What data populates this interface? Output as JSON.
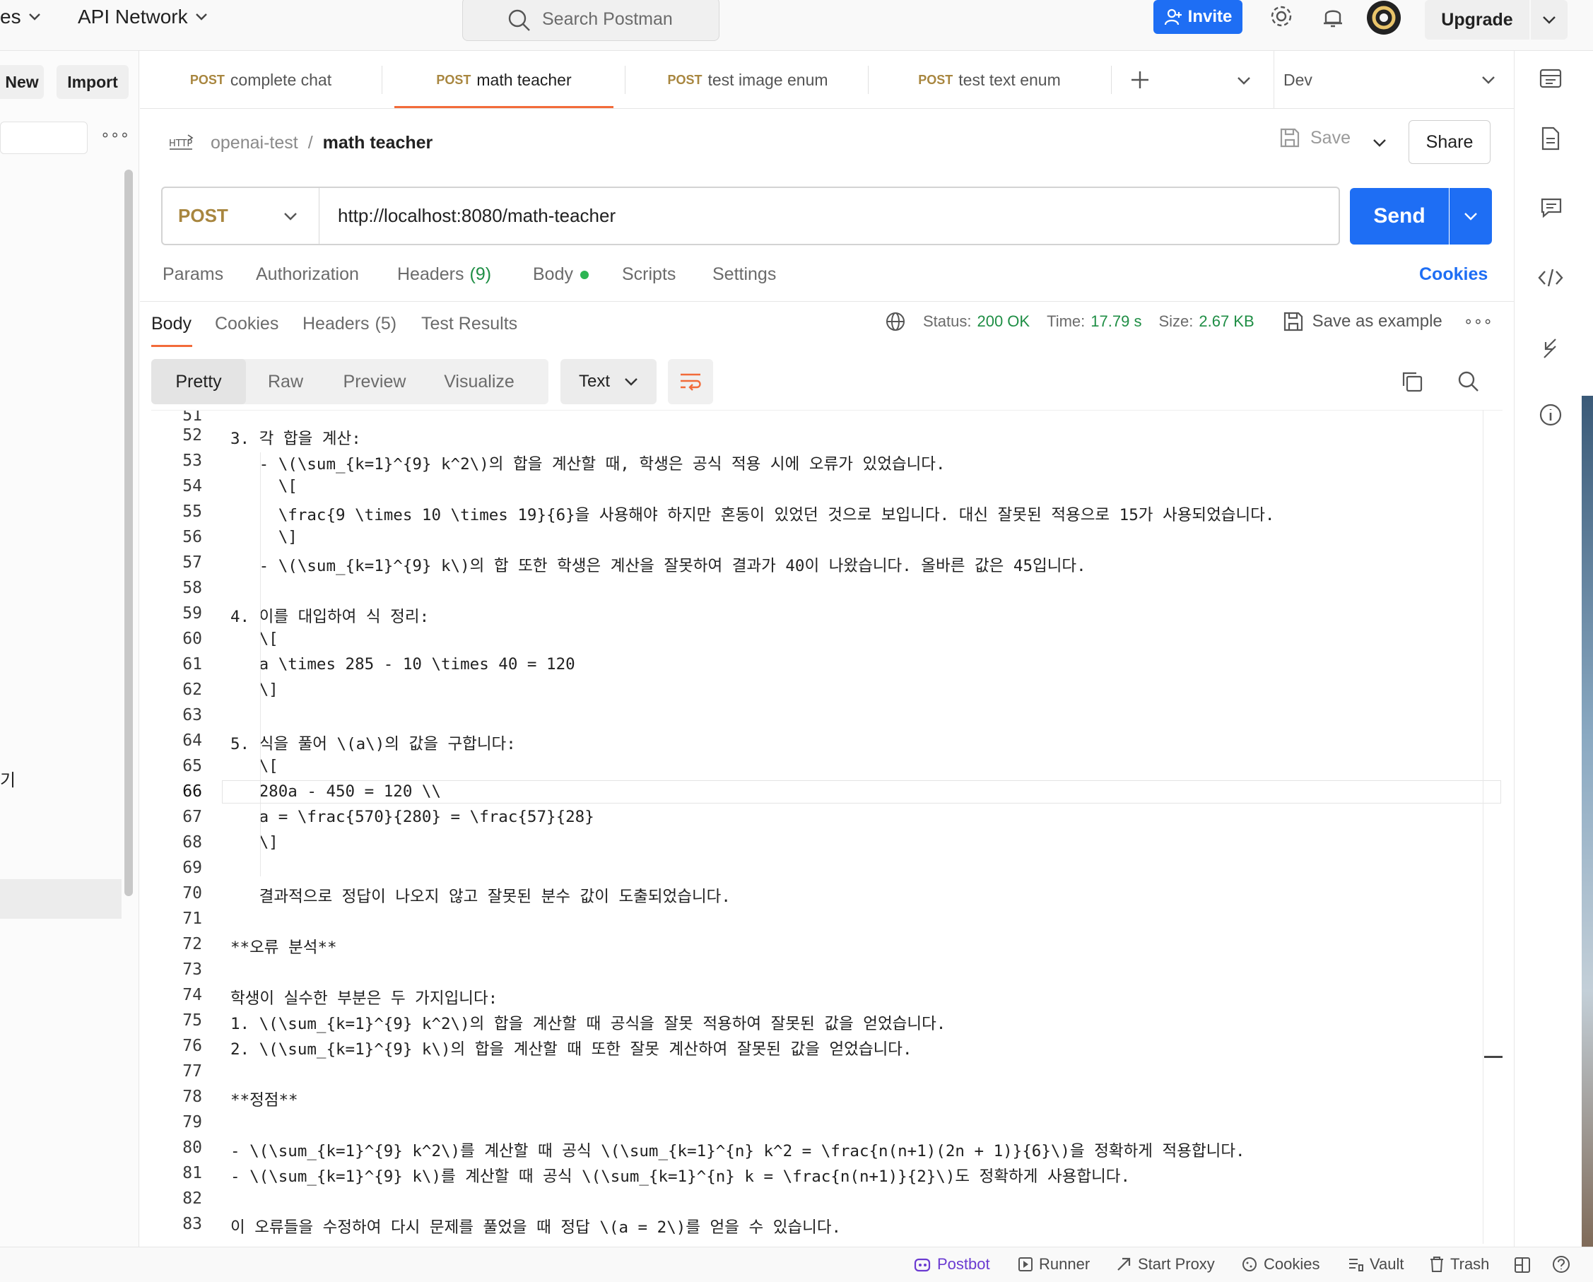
{
  "topbar": {
    "workspace_label": "es",
    "network_label": "API Network",
    "search_placeholder": "Search Postman",
    "invite_label": "Invite",
    "upgrade_label": "Upgrade"
  },
  "sidebar": {
    "new_label": "New",
    "import_label": "Import",
    "more_label": "∘∘∘",
    "partial_item": "기"
  },
  "tabs": [
    {
      "method": "POST",
      "label": "complete chat"
    },
    {
      "method": "POST",
      "label": "math teacher"
    },
    {
      "method": "POST",
      "label": "test image enum"
    },
    {
      "method": "POST",
      "label": "test text enum"
    }
  ],
  "environment": "Dev",
  "breadcrumb": {
    "collection": "openai-test",
    "separator": "/",
    "request": "math teacher"
  },
  "actions": {
    "save_label": "Save",
    "share_label": "Share"
  },
  "request": {
    "method": "POST",
    "url": "http://localhost:8080/math-teacher",
    "send_label": "Send",
    "tabs": [
      "Params",
      "Authorization",
      "Headers",
      "Body",
      "Scripts",
      "Settings"
    ],
    "headers_count": "(9)",
    "cookies_label": "Cookies"
  },
  "response": {
    "tabs": [
      "Body",
      "Cookies",
      "Headers",
      "Test Results"
    ],
    "headers_count": "(5)",
    "status_label": "Status:",
    "status_value": "200 OK",
    "time_label": "Time:",
    "time_value": "17.79 s",
    "size_label": "Size:",
    "size_value": "2.67 KB",
    "save_example_label": "Save as example",
    "view_modes": [
      "Pretty",
      "Raw",
      "Preview",
      "Visualize"
    ],
    "format": "Text"
  },
  "code": {
    "first_partial_line": "51",
    "current_line": 66,
    "lines": [
      {
        "n": "52",
        "t": "3. 각 합을 계산:"
      },
      {
        "n": "53",
        "t": "   - \\(\\sum_{k=1}^{9} k^2\\)의 합을 계산할 때, 학생은 공식 적용 시에 오류가 있었습니다."
      },
      {
        "n": "54",
        "t": "     \\["
      },
      {
        "n": "55",
        "t": "     \\frac{9 \\times 10 \\times 19}{6}을 사용해야 하지만 혼동이 있었던 것으로 보입니다. 대신 잘못된 적용으로 15가 사용되었습니다."
      },
      {
        "n": "56",
        "t": "     \\]"
      },
      {
        "n": "57",
        "t": "   - \\(\\sum_{k=1}^{9} k\\)의 합 또한 학생은 계산을 잘못하여 결과가 40이 나왔습니다. 올바른 값은 45입니다."
      },
      {
        "n": "58",
        "t": ""
      },
      {
        "n": "59",
        "t": "4. 이를 대입하여 식 정리:"
      },
      {
        "n": "60",
        "t": "   \\["
      },
      {
        "n": "61",
        "t": "   a \\times 285 - 10 \\times 40 = 120"
      },
      {
        "n": "62",
        "t": "   \\]"
      },
      {
        "n": "63",
        "t": ""
      },
      {
        "n": "64",
        "t": "5. 식을 풀어 \\(a\\)의 값을 구합니다:"
      },
      {
        "n": "65",
        "t": "   \\["
      },
      {
        "n": "66",
        "t": "   280a - 450 = 120 \\\\"
      },
      {
        "n": "67",
        "t": "   a = \\frac{570}{280} = \\frac{57}{28}"
      },
      {
        "n": "68",
        "t": "   \\]"
      },
      {
        "n": "69",
        "t": ""
      },
      {
        "n": "70",
        "t": "   결과적으로 정답이 나오지 않고 잘못된 분수 값이 도출되었습니다."
      },
      {
        "n": "71",
        "t": ""
      },
      {
        "n": "72",
        "t": "**오류 분석**"
      },
      {
        "n": "73",
        "t": ""
      },
      {
        "n": "74",
        "t": "학생이 실수한 부분은 두 가지입니다:"
      },
      {
        "n": "75",
        "t": "1. \\(\\sum_{k=1}^{9} k^2\\)의 합을 계산할 때 공식을 잘못 적용하여 잘못된 값을 얻었습니다."
      },
      {
        "n": "76",
        "t": "2. \\(\\sum_{k=1}^{9} k\\)의 합을 계산할 때 또한 잘못 계산하여 잘못된 값을 얻었습니다."
      },
      {
        "n": "77",
        "t": ""
      },
      {
        "n": "78",
        "t": "**정점**"
      },
      {
        "n": "79",
        "t": ""
      },
      {
        "n": "80",
        "t": "- \\(\\sum_{k=1}^{9} k^2\\)를 계산할 때 공식 \\(\\sum_{k=1}^{n} k^2 = \\frac{n(n+1)(2n + 1)}{6}\\)을 정확하게 적용합니다."
      },
      {
        "n": "81",
        "t": "- \\(\\sum_{k=1}^{9} k\\)를 계산할 때 공식 \\(\\sum_{k=1}^{n} k = \\frac{n(n+1)}{2}\\)도 정확하게 사용합니다."
      },
      {
        "n": "82",
        "t": ""
      },
      {
        "n": "83",
        "t": "이 오류들을 수정하여 다시 문제를 풀었을 때 정답 \\(a = 2\\)를 얻을 수 있습니다."
      }
    ]
  },
  "footer": {
    "postbot": "Postbot",
    "runner": "Runner",
    "proxy": "Start Proxy",
    "cookies": "Cookies",
    "vault": "Vault",
    "trash": "Trash"
  },
  "colors": {
    "accent": "#1e6ef4",
    "method_post": "#a8863f",
    "active_tab_underline": "#f26b3a",
    "status_ok": "#1f8e45"
  }
}
